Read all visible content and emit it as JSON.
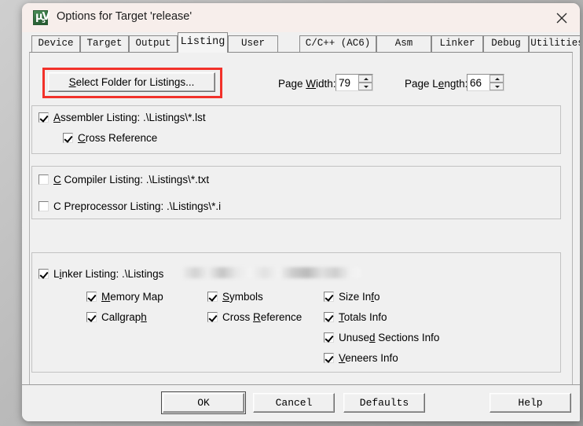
{
  "window": {
    "title": "Options for Target 'release'",
    "icon": "uvision-logo-icon",
    "close_label": "×",
    "mu_glyph": "µV",
    "version_glyph": "5"
  },
  "tabs": [
    {
      "label": "Device",
      "active": false
    },
    {
      "label": "Target",
      "active": false
    },
    {
      "label": "Output",
      "active": false
    },
    {
      "label": "Listing",
      "active": true
    },
    {
      "label": "User",
      "active": false
    },
    {
      "label": "C/C++ (AC6)",
      "active": false
    },
    {
      "label": "Asm",
      "active": false
    },
    {
      "label": "Linker",
      "active": false
    },
    {
      "label": "Debug",
      "active": false
    },
    {
      "label": "Utilities",
      "active": false
    }
  ],
  "toolbar": {
    "select_folder_label": "Select Folder for Listings...",
    "select_folder_accel": "S",
    "highlight_color": "#f2312a"
  },
  "page_width": {
    "label_before": "Page ",
    "label_accel": "W",
    "label_after": "idth:",
    "value": "79"
  },
  "page_length": {
    "label_before": "Page L",
    "label_accel": "e",
    "label_after": "ngth:",
    "value": "66"
  },
  "assembler_group": {
    "assembler_listing": {
      "accel": "A",
      "text_before": "",
      "text_after": "ssembler Listing:  .\\Listings\\*.lst",
      "checked": true
    },
    "cross_reference": {
      "accel": "C",
      "text_before": "",
      "text_after": "ross Reference",
      "checked": true
    }
  },
  "compiler_group": {
    "c_compiler_listing": {
      "accel": "C",
      "text_before": "",
      "text_after": " Compiler Listing:  .\\Listings\\*.txt",
      "checked": false
    },
    "c_preprocessor_listing": {
      "accel": "",
      "text_before": "C Preprocessor Listing:  .\\Listings\\*.i",
      "text_after": "",
      "checked": false
    }
  },
  "linker_group": {
    "linker_listing": {
      "text_before": "L",
      "accel": "i",
      "text_after": "nker Listing:  .\\Listings",
      "checked": true,
      "path_redacted": true
    },
    "options": [
      {
        "name": "memory-map",
        "text_before": "",
        "accel": "M",
        "text_after": "emory Map",
        "checked": true
      },
      {
        "name": "callgraph",
        "text_before": "Callgrap",
        "accel": "h",
        "text_after": "",
        "checked": true
      },
      {
        "name": "symbols",
        "text_before": "",
        "accel": "S",
        "text_after": "ymbols",
        "checked": true
      },
      {
        "name": "cross-reference",
        "text_before": "Cross ",
        "accel": "R",
        "text_after": "eference",
        "checked": true
      },
      {
        "name": "size-info",
        "text_before": "Size In",
        "accel": "f",
        "text_after": "o",
        "checked": true
      },
      {
        "name": "totals-info",
        "text_before": "",
        "accel": "T",
        "text_after": "otals Info",
        "checked": true
      },
      {
        "name": "unused-sections-info",
        "text_before": "Unuse",
        "accel": "d",
        "text_after": " Sections Info",
        "checked": true
      },
      {
        "name": "veneers-info",
        "text_before": "",
        "accel": "V",
        "text_after": "eneers Info",
        "checked": true
      }
    ]
  },
  "footer": {
    "ok_label": "OK",
    "cancel_label": "Cancel",
    "defaults_label": "Defaults",
    "help_label": "Help"
  }
}
